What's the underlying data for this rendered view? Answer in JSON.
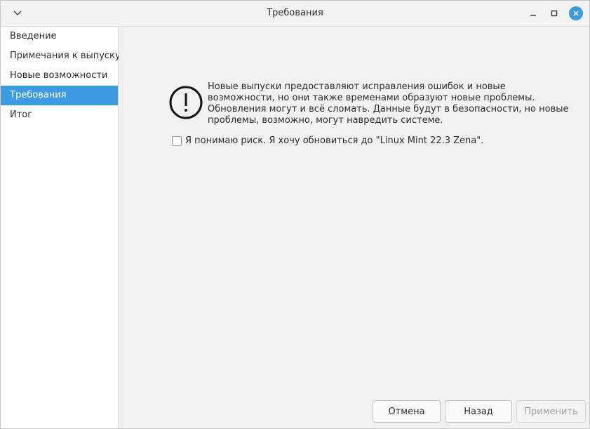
{
  "window": {
    "title": "Требования"
  },
  "titlebar_icons": {
    "menu": "chevron-down-icon",
    "minimize": "minimize-icon",
    "maximize": "maximize-icon",
    "close": "close-icon"
  },
  "sidebar": {
    "items": [
      {
        "label": "Введение",
        "active": false
      },
      {
        "label": "Примечания к выпуску",
        "active": false
      },
      {
        "label": "Новые возможности",
        "active": false
      },
      {
        "label": "Требования",
        "active": true
      },
      {
        "label": "Итог",
        "active": false
      }
    ]
  },
  "warning": {
    "icon": "exclamation-circle-icon",
    "lines": [
      "Новые выпуски предоставляют исправления ошибок и новые",
      "возможности, но они также временами образуют новые проблемы.",
      "Обновления могут и всё сломать. Данные будут в безопасности, но новые",
      "проблемы, возможно, могут навредить системе."
    ]
  },
  "checkbox": {
    "label": "Я понимаю риск. Я хочу обновиться до \"Linux Mint 22.3 Zena\".",
    "checked": false
  },
  "buttons": {
    "cancel": "Отмена",
    "back": "Назад",
    "apply": "Применить"
  },
  "colors": {
    "accent": "#3d9be0",
    "disabled_text": "#a0a0a0"
  }
}
